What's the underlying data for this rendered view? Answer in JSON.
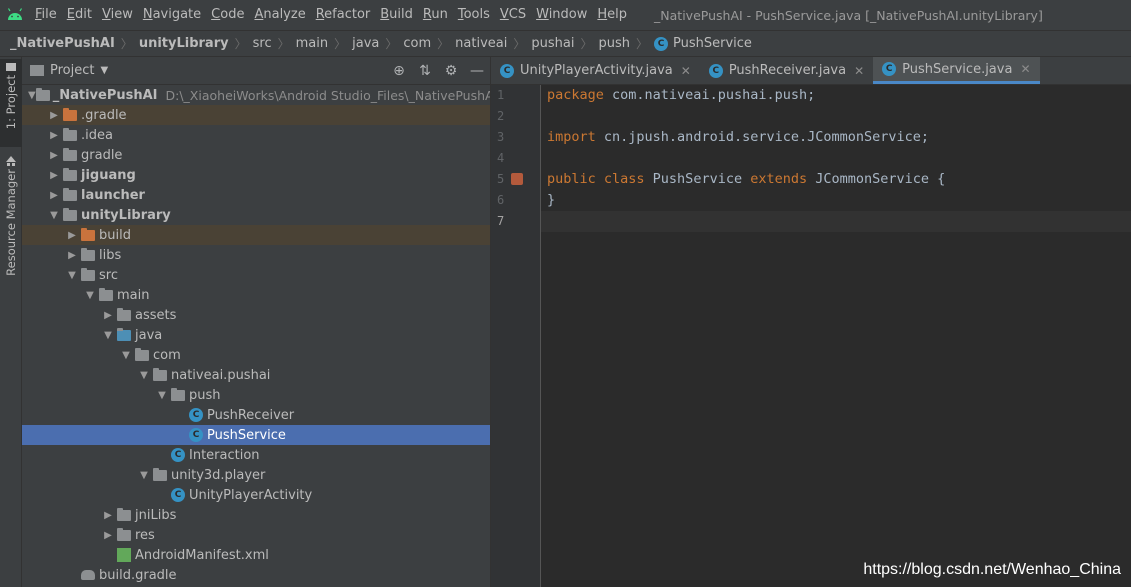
{
  "menubar": {
    "items": [
      "File",
      "Edit",
      "View",
      "Navigate",
      "Code",
      "Analyze",
      "Refactor",
      "Build",
      "Run",
      "Tools",
      "VCS",
      "Window",
      "Help"
    ],
    "window_title": "_NativePushAI - PushService.java [_NativePushAI.unityLibrary]"
  },
  "breadcrumb": [
    "_NativePushAI",
    "unityLibrary",
    "src",
    "main",
    "java",
    "com",
    "nativeai",
    "pushai",
    "push",
    "PushService"
  ],
  "toolstrip": {
    "project_tab": "1: Project",
    "resource_tab": "Resource Manager"
  },
  "project_panel": {
    "title": "Project",
    "root_name": "_NativePushAI",
    "root_path": "D:\\_XiaoheiWorks\\Android Studio_Files\\_NativePushAI",
    "items": [
      ".gradle",
      ".idea",
      "gradle",
      "jiguang",
      "launcher",
      "unityLibrary",
      "build",
      "libs",
      "src",
      "main",
      "assets",
      "java",
      "com",
      "nativeai.pushai",
      "push",
      "PushReceiver",
      "PushService",
      "Interaction",
      "unity3d.player",
      "UnityPlayerActivity",
      "jniLibs",
      "res",
      "AndroidManifest.xml",
      "build.gradle"
    ]
  },
  "editor": {
    "tabs": [
      {
        "label": "UnityPlayerActivity.java"
      },
      {
        "label": "PushReceiver.java"
      },
      {
        "label": "PushService.java"
      }
    ],
    "line_numbers": [
      "1",
      "2",
      "3",
      "4",
      "5",
      "6",
      "7"
    ],
    "code": {
      "l1_kw": "package",
      "l1_rest": " com.nativeai.pushai.push;",
      "l3_kw": "import",
      "l3_rest": " cn.jpush.android.service.JCommonService;",
      "l5_kw1": "public class",
      "l5_name": " PushService ",
      "l5_kw2": "extends",
      "l5_rest": " JCommonService {",
      "l6": "}"
    }
  },
  "watermark": "https://blog.csdn.net/Wenhao_China",
  "colors": {
    "keyword": "#cc7832",
    "selection": "#4b6eaf",
    "excluded_row": "#4a4235",
    "class_icon": "#3592c4",
    "active_tab_underline": "#4a88c7"
  }
}
